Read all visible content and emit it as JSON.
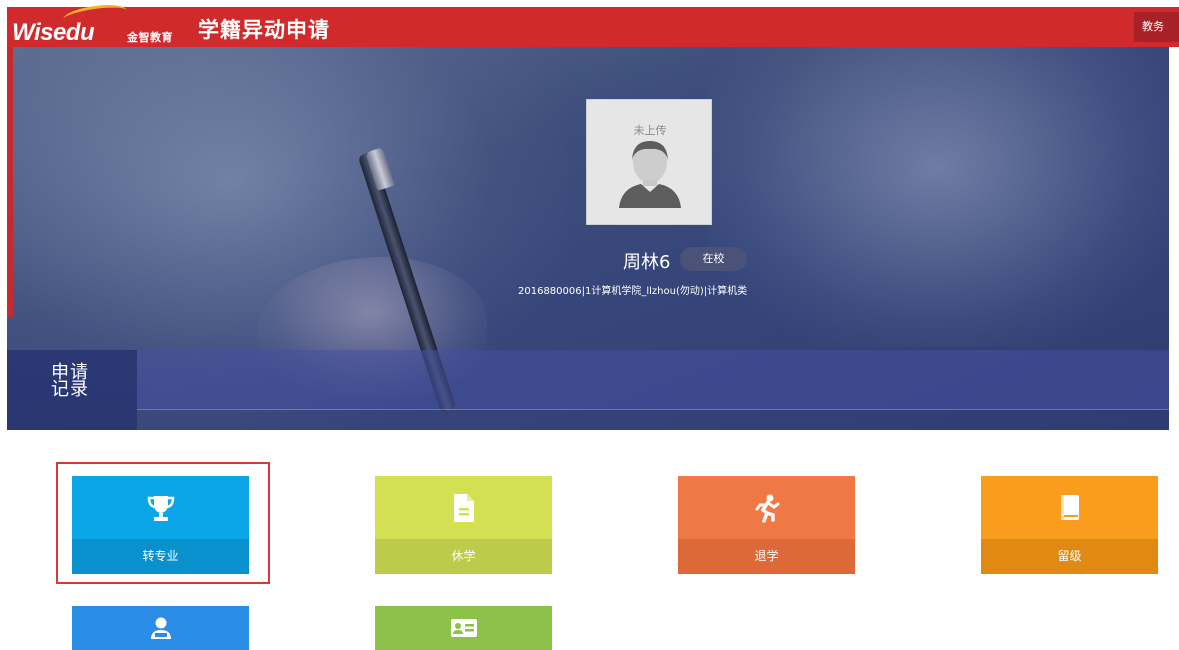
{
  "header": {
    "logo_text": "Wisedu",
    "logo_cn": "金智教育",
    "app_title": "学籍异动申请",
    "top_right_label": "教务"
  },
  "profile": {
    "avatar_note": "未上传",
    "name": "周林6",
    "status": "在校",
    "info": "2016880006|1计算机学院_llzhou(勿动)|计算机类"
  },
  "records": {
    "label": "申请记录"
  },
  "tiles": [
    {
      "label": "转专业",
      "icon": "trophy-icon",
      "color": "#0aa6e8",
      "label_color": "#0891cc"
    },
    {
      "label": "休学",
      "icon": "document-icon",
      "color": "#d3e052",
      "label_color": "#bccb4a"
    },
    {
      "label": "退学",
      "icon": "running-person-icon",
      "color": "#f07845",
      "label_color": "#dd6838"
    },
    {
      "label": "留级",
      "icon": "book-icon",
      "color": "#fa9c1c",
      "label_color": "#e08a13"
    },
    {
      "label": "",
      "icon": "user-reading-icon",
      "color": "#2a8ee6"
    },
    {
      "label": "",
      "icon": "id-card-icon",
      "color": "#8dc24a"
    }
  ],
  "colors": {
    "header_red": "#d02a2c",
    "selection_border": "#d8383a"
  }
}
